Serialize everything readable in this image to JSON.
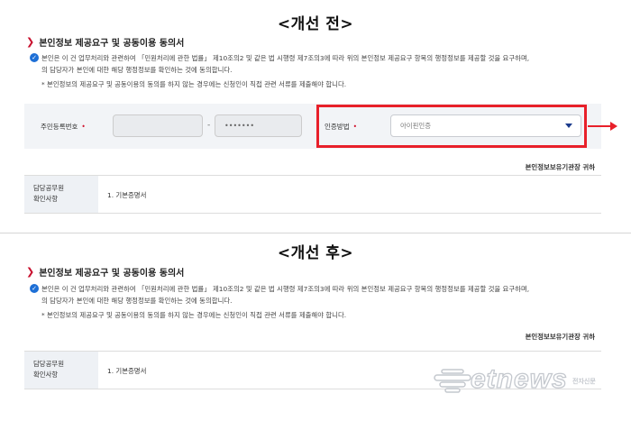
{
  "before": {
    "heading": "<개선 전>",
    "section_title": "본인정보 제공요구 및 공동이용 동의서",
    "consent_line1": "본인은 이 건 업무처리와 관련하여 「민원처리에 관한 법률」 제10조의2 및 같은 법 시행령 제7조의3에 따라 위의 본인정보 제공요구 항목의 행정정보를 제공할 것을 요구하며,",
    "consent_line2": "의 담당자가 본인에 대한 해당 행정정보를 확인하는 것에 동의합니다.",
    "consent_note": "* 본인정보의 제공요구 및 공동이용의 동의를 하지 않는 경우에는 신청인이 직접 관련 서류를 제출해야 합니다.",
    "ssn_label": "주민등록번호",
    "ssn_required": "•",
    "ssn_part1": "",
    "ssn_dash": "-",
    "ssn_part2": "•••••••",
    "auth_label": "인증방법",
    "auth_required": "•",
    "auth_value": "아이핀인증",
    "org_label": "본인정보보유기관장 귀하",
    "officer_label_1": "담당공무원",
    "officer_label_2": "확인사항",
    "officer_value": "1. 기본증명서"
  },
  "after": {
    "heading": "<개선 후>",
    "section_title": "본인정보 제공요구 및 공동이용 동의서",
    "consent_line1": "본인은 이 건 업무처리와 관련하여 「민원처리에 관한 법률」 제10조의2 및 같은 법 시행령 제7조의3에 따라 위의 본인정보 제공요구 항목의 행정정보를 제공할 것을 요구하며,",
    "consent_line2": "의 담당자가 본인에 대한 해당 행정정보를 확인하는 것에 동의합니다.",
    "consent_note": "* 본인정보의 제공요구 및 공동이용의 동의를 하지 않는 경우에는 신청인이 직접 관련 서류를 제출해야 합니다.",
    "org_label": "본인정보보유기관장 귀하",
    "officer_label_1": "담당공무원",
    "officer_label_2": "확인사항",
    "officer_value": "1. 기본증명서"
  },
  "watermark": {
    "brand": "etnews",
    "sub": "전자신문"
  },
  "colors": {
    "accent_red": "#e8202a",
    "check_blue": "#1d6fd6",
    "required_red": "#d0112b"
  },
  "icons": {
    "section_bullet": "chevron-right-icon",
    "consent_check": "check-circle-icon",
    "select_caret": "caret-down-icon",
    "annotation_arrow": "arrow-right-icon"
  }
}
